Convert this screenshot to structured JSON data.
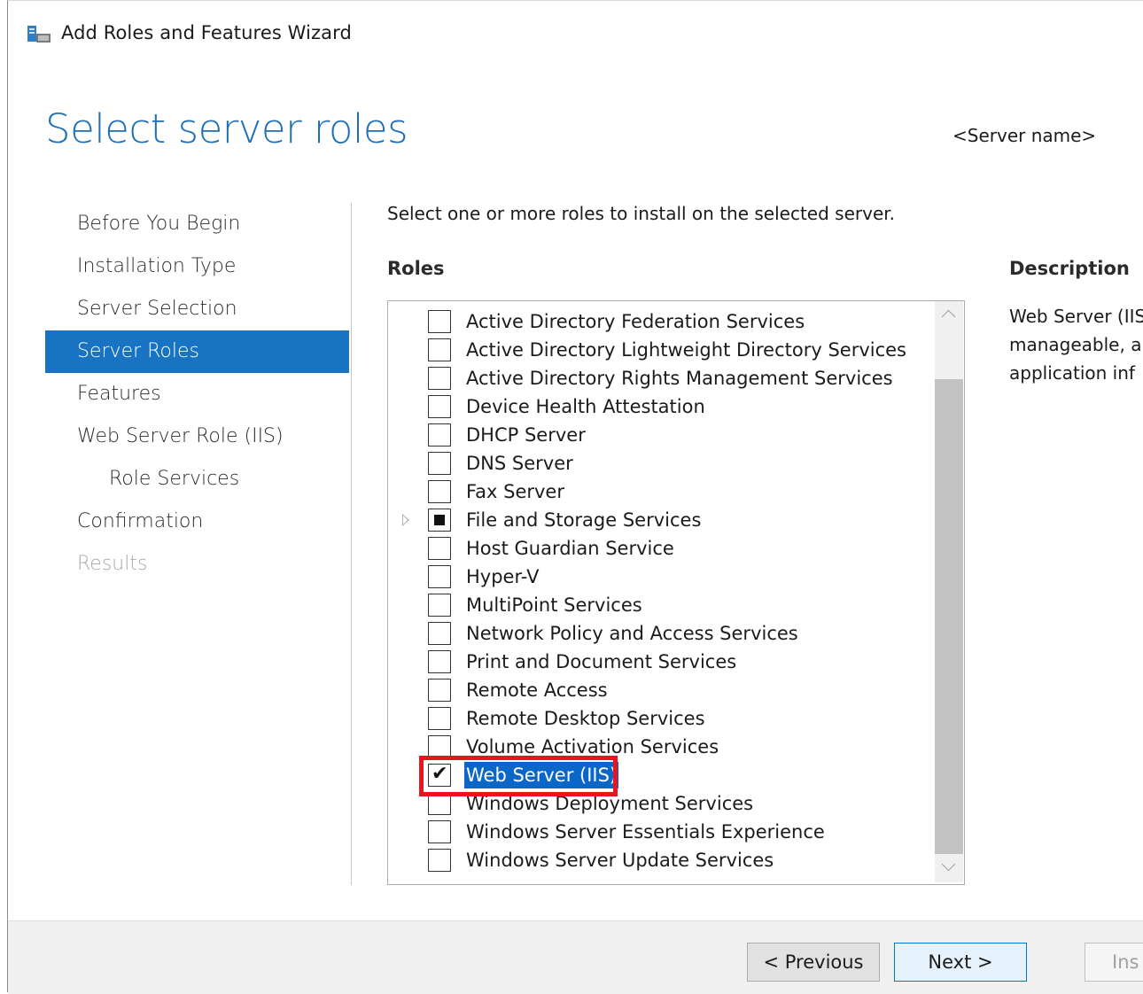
{
  "window": {
    "title": "Add Roles and Features Wizard"
  },
  "page": {
    "title": "Select server roles",
    "server_name": "<Server name>"
  },
  "nav": {
    "items": [
      {
        "label": "Before You Begin"
      },
      {
        "label": "Installation Type"
      },
      {
        "label": "Server Selection"
      },
      {
        "label": "Server Roles"
      },
      {
        "label": "Features"
      },
      {
        "label": "Web Server Role (IIS)"
      },
      {
        "label": "Role Services"
      },
      {
        "label": "Confirmation"
      },
      {
        "label": "Results"
      }
    ],
    "active": "Server Roles"
  },
  "main": {
    "instruction": "Select one or more roles to install on the selected server.",
    "roles_header": "Roles",
    "description_header": "Description",
    "description_lines": [
      "Web Server (IIS",
      "manageable, a",
      "application inf"
    ]
  },
  "roles": [
    {
      "label": "Active Directory Federation Services",
      "state": "unchecked"
    },
    {
      "label": "Active Directory Lightweight Directory Services",
      "state": "unchecked"
    },
    {
      "label": "Active Directory Rights Management Services",
      "state": "unchecked"
    },
    {
      "label": "Device Health Attestation",
      "state": "unchecked"
    },
    {
      "label": "DHCP Server",
      "state": "unchecked"
    },
    {
      "label": "DNS Server",
      "state": "unchecked"
    },
    {
      "label": "Fax Server",
      "state": "unchecked"
    },
    {
      "label": "File and Storage Services",
      "state": "partial"
    },
    {
      "label": "Host Guardian Service",
      "state": "unchecked"
    },
    {
      "label": "Hyper-V",
      "state": "unchecked"
    },
    {
      "label": "MultiPoint Services",
      "state": "unchecked"
    },
    {
      "label": "Network Policy and Access Services",
      "state": "unchecked"
    },
    {
      "label": "Print and Document Services",
      "state": "unchecked"
    },
    {
      "label": "Remote Access",
      "state": "unchecked"
    },
    {
      "label": "Remote Desktop Services",
      "state": "unchecked"
    },
    {
      "label": "Volume Activation Services",
      "state": "unchecked"
    },
    {
      "label": "Web Server (IIS)",
      "state": "checked"
    },
    {
      "label": "Windows Deployment Services",
      "state": "unchecked"
    },
    {
      "label": "Windows Server Essentials Experience",
      "state": "unchecked"
    },
    {
      "label": "Windows Server Update Services",
      "state": "unchecked"
    }
  ],
  "footer": {
    "previous": "< Previous",
    "next": "Next >",
    "install": "Ins"
  },
  "colors": {
    "accent": "#1874c2",
    "selection": "#0a67c8",
    "highlight": "#e8141f",
    "title": "#1e6fb8"
  }
}
